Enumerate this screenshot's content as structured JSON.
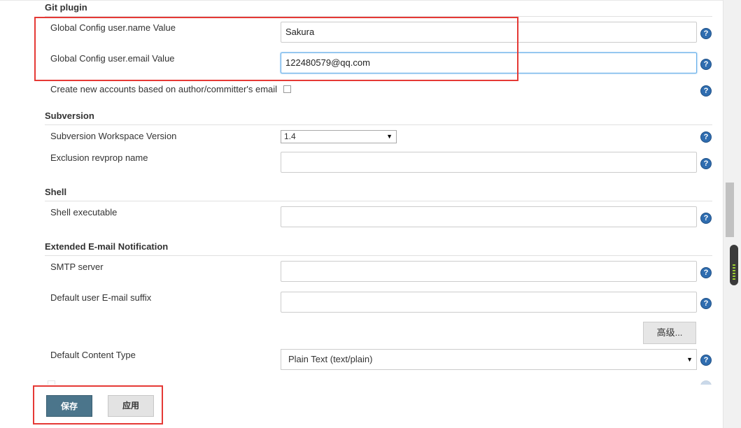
{
  "sections": {
    "git": {
      "title": "Git plugin",
      "user_name_label": "Global Config user.name Value",
      "user_name_value": "Sakura",
      "user_email_label": "Global Config user.email Value",
      "user_email_value": "122480579@qq.com",
      "create_accounts_label": "Create new accounts based on author/committer's email"
    },
    "subversion": {
      "title": "Subversion",
      "workspace_version_label": "Subversion Workspace Version",
      "workspace_version_value": "1.4",
      "exclusion_label": "Exclusion revprop name"
    },
    "shell": {
      "title": "Shell",
      "executable_label": "Shell executable"
    },
    "email": {
      "title": "Extended E-mail Notification",
      "smtp_label": "SMTP server",
      "suffix_label": "Default user E-mail suffix",
      "advanced_button": "高级...",
      "content_type_label": "Default Content Type",
      "content_type_value": "Plain Text (text/plain)"
    }
  },
  "help_glyph": "?",
  "select_arrow": "▼",
  "buttons": {
    "save": "保存",
    "apply": "应用"
  },
  "colors": {
    "save_button": "#4b758b",
    "highlight_box": "#e53935",
    "help_icon": "#2f6db0"
  }
}
